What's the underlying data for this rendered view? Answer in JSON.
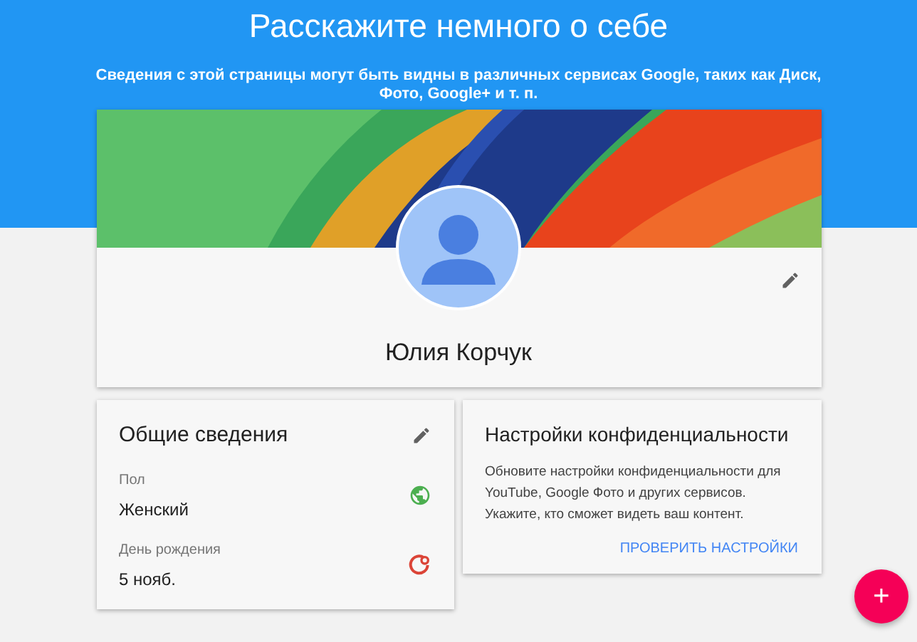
{
  "header": {
    "title": "Расскажите немного о себе",
    "subtitle": "Сведения с этой страницы могут быть видны в различных сервисах Google, таких как Диск, Фото, Google+ и т. п."
  },
  "profile": {
    "name": "Юлия Корчук"
  },
  "general": {
    "title": "Общие сведения",
    "fields": [
      {
        "label": "Пол",
        "value": "Женский",
        "kind": "public",
        "color": "#4caf50"
      },
      {
        "label": "День рождения",
        "value": "5 нояб.",
        "kind": "circles",
        "color": "#db4437"
      }
    ]
  },
  "privacy": {
    "title": "Настройки конфиденциальности",
    "text": "Обновите настройки конфиденциальности для YouTube, Google Фото и других сервисов. Укажите, кто сможет видеть ваш контент.",
    "action": "ПРОВЕРИТЬ НАСТРОЙКИ"
  },
  "fab": {
    "label": "+"
  }
}
